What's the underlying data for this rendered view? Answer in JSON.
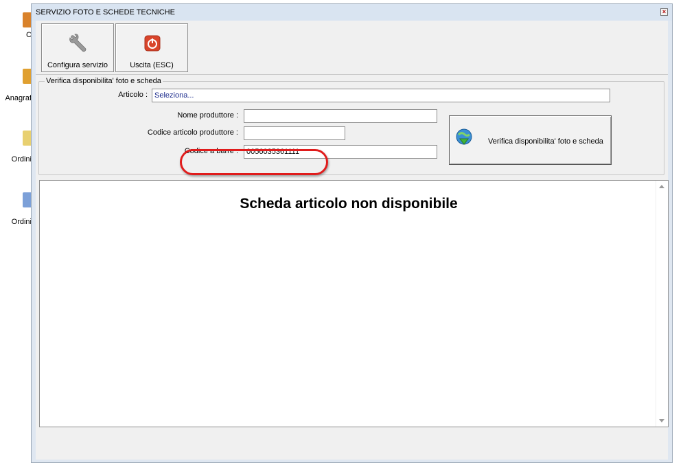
{
  "desktop": {
    "items": [
      {
        "label": "C"
      },
      {
        "label": "Anagraf"
      },
      {
        "label": "Ordini"
      },
      {
        "label": "Ordini"
      }
    ]
  },
  "window": {
    "title": "SERVIZIO FOTO E SCHEDE TECNICHE",
    "close_glyph": "×"
  },
  "toolbar": {
    "config_label": "Configura servizio",
    "exit_label": "Uscita (ESC)"
  },
  "group": {
    "legend": "Verifica disponibilita' foto e scheda",
    "articolo_label": "Articolo :",
    "articolo_value": "Seleziona...",
    "nome_produttore_label": "Nome produttore :",
    "nome_produttore_value": "",
    "codice_articolo_label": "Codice articolo produttore :",
    "codice_articolo_value": "",
    "codice_barre_label": "Codice a barre :",
    "codice_barre_value": "0056035361111",
    "verify_label": "Verifica disponibilita' foto e scheda"
  },
  "pane": {
    "message": "Scheda articolo non disponibile"
  },
  "colors": {
    "highlight": "#e01c1c",
    "exit_icon": "#d9452b",
    "text_blue": "#1a2a8c"
  }
}
